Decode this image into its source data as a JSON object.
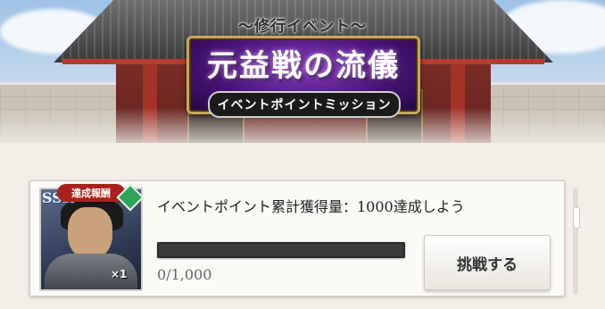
{
  "banner": {
    "top_label": "〜修行イベント〜",
    "title": "元益戦の流儀",
    "subtitle": "イベントポイントミッション"
  },
  "mission": {
    "reward_tag": "達成報酬",
    "reward_rarity": "SSR",
    "reward_quantity": "×1",
    "description": "イベントポイント累計獲得量：1000達成しよう",
    "progress_text": "0/1,000",
    "progress_fraction": 0,
    "challenge_label": "挑戦する"
  },
  "colors": {
    "banner_purple": "#4b1479",
    "banner_gold": "#c9a85a",
    "tag_red": "#a8221b",
    "progress_track": "#3a3a3a"
  },
  "icons": [
    "reward-character-icon",
    "element-gem-icon"
  ]
}
